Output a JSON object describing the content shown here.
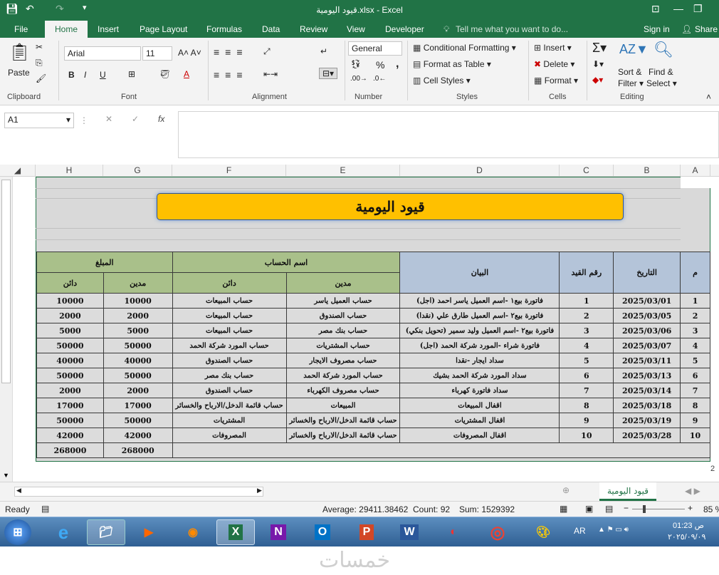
{
  "window": {
    "title": "قيود اليومية.xlsx - Excel"
  },
  "tabs": [
    "File",
    "Home",
    "Insert",
    "Page Layout",
    "Formulas",
    "Data",
    "Review",
    "View",
    "Developer"
  ],
  "tell_me": "Tell me what you want to do...",
  "account": {
    "sign_in": "Sign in",
    "share": "Share"
  },
  "ribbon": {
    "clipboard": {
      "paste": "Paste",
      "label": "Clipboard"
    },
    "font": {
      "name": "Arial",
      "size": "11",
      "bold": "B",
      "italic": "I",
      "underline": "U",
      "label": "Font"
    },
    "alignment": {
      "label": "Alignment"
    },
    "number": {
      "format": "General",
      "percent": "%",
      "comma": ",",
      "label": "Number"
    },
    "styles": {
      "conditional": "Conditional Formatting",
      "format_table": "Format as Table",
      "cell_styles": "Cell Styles",
      "label": "Styles"
    },
    "cells": {
      "insert": "Insert",
      "delete": "Delete",
      "format": "Format",
      "label": "Cells"
    },
    "editing": {
      "sort": "Sort &",
      "filter": "Filter",
      "find": "Find &",
      "select": "Select",
      "label": "Editing"
    }
  },
  "formula_bar": {
    "name_box": "A1",
    "fx": "fx",
    "value": ""
  },
  "columns": [
    "H",
    "G",
    "F",
    "E",
    "D",
    "C",
    "B",
    "A"
  ],
  "sheet": {
    "banner": "قيود اليومية",
    "headers": {
      "m": "م",
      "date": "التاريخ",
      "entry_no": "رقم القيد",
      "statement": "البيان",
      "account_name": "اسم الحساب",
      "debit_account": "مدين",
      "credit_account": "دائن",
      "amount": "المبلغ",
      "debit_amount": "مدين",
      "credit_amount": "دائن"
    },
    "rows": [
      {
        "m": "1",
        "date": "2025/03/01",
        "no": "1",
        "desc": "فاتورة بيع١ -اسم العميل ياسر احمد (اجل)",
        "debit_acc": "حساب العميل ياسر",
        "credit_acc": "حساب المبيعات",
        "debit": "10000",
        "credit": "10000"
      },
      {
        "m": "2",
        "date": "2025/03/05",
        "no": "2",
        "desc": "فاتورة بيع٢ -اسم العميل طارق علي (نقدا)",
        "debit_acc": "حساب الصندوق",
        "credit_acc": "حساب المبيعات",
        "debit": "2000",
        "credit": "2000"
      },
      {
        "m": "3",
        "date": "2025/03/06",
        "no": "3",
        "desc": "فاتورة بيع٢ -اسم العميل وليد سمير (تحويل بنكي)",
        "debit_acc": "حساب بنك مصر",
        "credit_acc": "حساب المبيعات",
        "debit": "5000",
        "credit": "5000"
      },
      {
        "m": "4",
        "date": "2025/03/07",
        "no": "4",
        "desc": "فاتورة شراء -المورد شركة الحمد (اجل)",
        "debit_acc": "حساب المشتريات",
        "credit_acc": "حساب المورد شركة الحمد",
        "debit": "50000",
        "credit": "50000"
      },
      {
        "m": "5",
        "date": "2025/03/11",
        "no": "5",
        "desc": "سداد ايجار -نقدا",
        "debit_acc": "حساب مصروف الايجار",
        "credit_acc": "حساب الصندوق",
        "debit": "40000",
        "credit": "40000"
      },
      {
        "m": "6",
        "date": "2025/03/13",
        "no": "6",
        "desc": "سداد المورد شركة الحمد بشيك",
        "debit_acc": "حساب المورد شركة الحمد",
        "credit_acc": "حساب بنك مصر",
        "debit": "50000",
        "credit": "50000"
      },
      {
        "m": "7",
        "date": "2025/03/14",
        "no": "7",
        "desc": "سداد فاتورة كهرباء",
        "debit_acc": "حساب مصروف الكهرباء",
        "credit_acc": "حساب الصندوق",
        "debit": "2000",
        "credit": "2000"
      },
      {
        "m": "8",
        "date": "2025/03/18",
        "no": "8",
        "desc": "اقفال المبيعات",
        "debit_acc": "المبيعات",
        "credit_acc": "حساب قائمة الدخل/الارباح والخسائر",
        "debit": "17000",
        "credit": "17000"
      },
      {
        "m": "9",
        "date": "2025/03/19",
        "no": "9",
        "desc": "اقفال المشتريات",
        "debit_acc": "حساب قائمة الدخل/الارباح والخسائر",
        "credit_acc": "المشتريات",
        "debit": "50000",
        "credit": "50000"
      },
      {
        "m": "10",
        "date": "2025/03/28",
        "no": "10",
        "desc": "اقفال المصروفات",
        "debit_acc": "حساب قائمة الدخل/الارباح والخسائر",
        "credit_acc": "المصروفات",
        "debit": "42000",
        "credit": "42000"
      }
    ],
    "totals": {
      "debit": "268000",
      "credit": "268000"
    }
  },
  "sheet_tab": "قيود اليومية",
  "status": {
    "ready": "Ready",
    "average": "Average: 29411.38462",
    "count": "Count: 92",
    "sum": "Sum: 1529392",
    "zoom": "85 %"
  },
  "taskbar": {
    "lang": "AR",
    "time": "01:23 ص",
    "date": "٢٠٢٥/٠٩/٠٩"
  },
  "watermark": "خمسات",
  "colors": {
    "excel_green": "#217346",
    "header_green": "#a9c08a",
    "header_blue": "#b4c4d9",
    "banner": "#ffc000"
  }
}
